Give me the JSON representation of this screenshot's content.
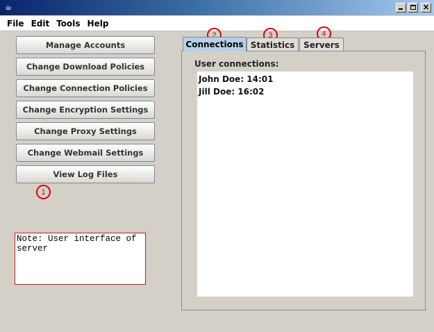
{
  "window": {
    "app_icon": "java-cup-icon",
    "buttons": [
      "minimize-icon",
      "maximize-icon",
      "close-icon"
    ],
    "close_glyph": "×"
  },
  "menu": {
    "items": [
      "File",
      "Edit",
      "Tools",
      "Help"
    ]
  },
  "left_buttons": [
    "Manage Accounts",
    "Change Download Policies",
    "Change Connection Policies",
    "Change Encryption Settings",
    "Change Proxy Settings",
    "Change Webmail Settings",
    "View Log Files"
  ],
  "markers": [
    "1",
    "2",
    "3",
    "4"
  ],
  "note": {
    "text": "Note: User interface of server"
  },
  "tabs": [
    {
      "label": "Connections",
      "active": true
    },
    {
      "label": "Statistics",
      "active": false
    },
    {
      "label": "Servers",
      "active": false
    }
  ],
  "connections_panel": {
    "label": "User connections:",
    "items": [
      "John Doe: 14:01",
      "Jill Doe: 16:02"
    ]
  },
  "colors": {
    "titlebar_start": "#0a246a",
    "titlebar_end": "#a6caf0",
    "marker": "#d80000",
    "active_tab": "#b8cfe5",
    "background": "#d4d0c8"
  }
}
